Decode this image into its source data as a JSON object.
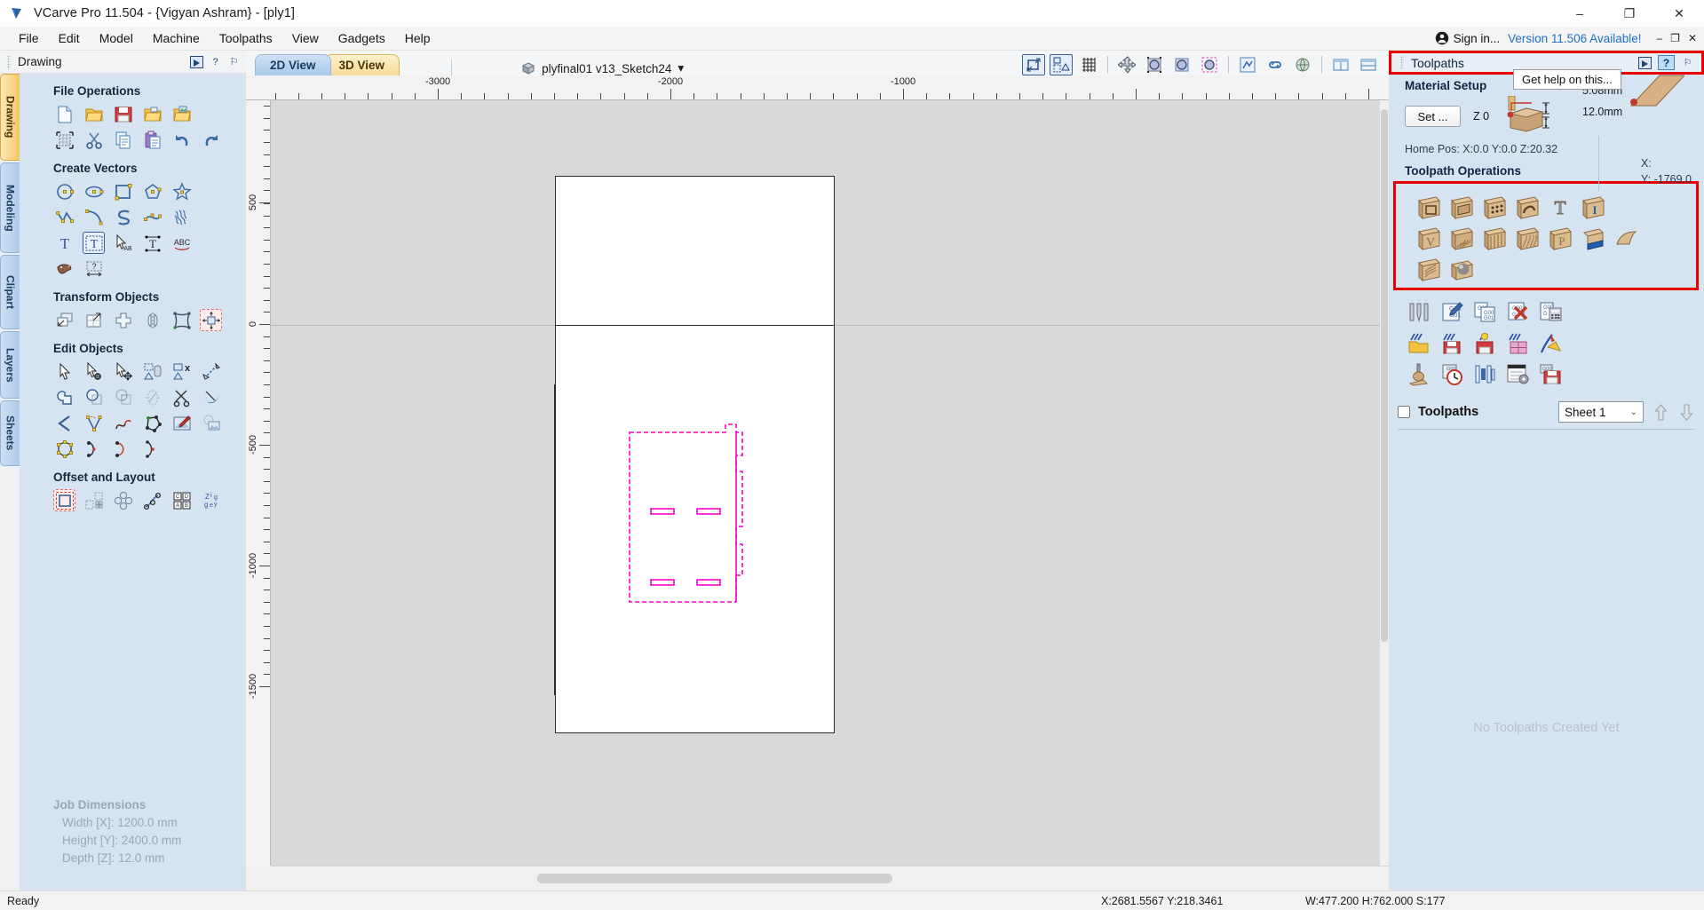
{
  "window": {
    "title": "VCarve Pro 11.504 - {Vigyan Ashram} - [ply1]",
    "logo_icon": "vcarve-logo-icon",
    "minimize": "–",
    "maximize": "❐",
    "close": "✕"
  },
  "menu": {
    "items": [
      {
        "label": "File",
        "name": "menu-file"
      },
      {
        "label": "Edit",
        "name": "menu-edit"
      },
      {
        "label": "Model",
        "name": "menu-model"
      },
      {
        "label": "Machine",
        "name": "menu-machine"
      },
      {
        "label": "Toolpaths",
        "name": "menu-toolpaths"
      },
      {
        "label": "View",
        "name": "menu-view"
      },
      {
        "label": "Gadgets",
        "name": "menu-gadgets"
      },
      {
        "label": "Help",
        "name": "menu-help"
      }
    ],
    "sign_in": "Sign in...",
    "version_notice": "Version 11.506 Available!",
    "mdi_minimize": "–",
    "mdi_restore": "❐",
    "mdi_close": "✕"
  },
  "left_panel": {
    "header_title": "Drawing",
    "help_mark": "?",
    "pin_mark": "⚐",
    "tabs": [
      {
        "label": "Drawing",
        "active": true
      },
      {
        "label": "Modeling",
        "active": false
      },
      {
        "label": "Clipart",
        "active": false
      },
      {
        "label": "Layers",
        "active": false
      },
      {
        "label": "Sheets",
        "active": false
      }
    ],
    "sections": [
      {
        "title": "File Operations"
      },
      {
        "title": "Create Vectors"
      },
      {
        "title": "Transform Objects"
      },
      {
        "title": "Edit Objects"
      },
      {
        "title": "Offset and Layout"
      }
    ],
    "job_dimensions": {
      "title": "Job Dimensions",
      "width": "Width  [X]: 1200.0 mm",
      "height": "Height [Y]: 2400.0 mm",
      "depth": "Depth  [Z]: 12.0 mm"
    }
  },
  "center": {
    "tabs": [
      {
        "label": "2D View",
        "active": true
      },
      {
        "label": "3D View",
        "active": false
      }
    ],
    "file_name": "plyfinal01 v13_Sketch24",
    "file_dropdown_caret": "▾",
    "ruler_h_labels": [
      "-3000",
      "-2000",
      "-1000"
    ],
    "ruler_v_labels": [
      "500",
      "0",
      "-500",
      "-1000",
      "-1500"
    ]
  },
  "right_panel": {
    "header_title": "Toolpaths",
    "help_mark": "?",
    "pin_mark": "⚐",
    "tooltip": "Get help on this...",
    "material_setup": {
      "title": "Material Setup",
      "set_button": "Set ...",
      "z_zero": "Z 0",
      "above_thickness": "5.08mm",
      "material_thickness": "12.0mm",
      "home_pos": "Home Pos:  X:0.0 Y:0.0 Z:20.32",
      "x_label": "X:",
      "y_label": "Y: -1769.0"
    },
    "toolpath_operations": {
      "title": "Toolpath Operations"
    },
    "toolpath_list": {
      "checkbox_label": "Toolpaths",
      "sheet_value": "Sheet 1",
      "chevron": "⌄",
      "move_up_icon": "arrow-up-icon",
      "move_down_icon": "arrow-down-icon",
      "empty_message": "No Toolpaths Created Yet"
    }
  },
  "status_bar": {
    "ready": "Ready",
    "coords": "X:2681.5567 Y:218.3461",
    "dimensions": "W:477.200  H:762.000  S:177"
  },
  "colors": {
    "accent_red": "#e60000",
    "link_blue": "#1f6fc4",
    "panel_blue": "#d6e3f0",
    "vector_magenta": "#ff00c8"
  }
}
